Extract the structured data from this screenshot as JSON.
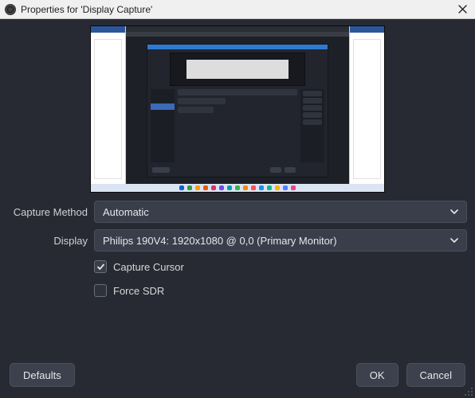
{
  "window": {
    "title": "Properties for 'Display Capture'"
  },
  "form": {
    "capture_method": {
      "label": "Capture Method",
      "value": "Automatic"
    },
    "display": {
      "label": "Display",
      "value": "Philips 190V4: 1920x1080 @ 0,0 (Primary Monitor)"
    },
    "capture_cursor": {
      "label": "Capture Cursor",
      "checked": true
    },
    "force_sdr": {
      "label": "Force SDR",
      "checked": false
    }
  },
  "buttons": {
    "defaults": "Defaults",
    "ok": "OK",
    "cancel": "Cancel"
  },
  "taskbar_icon_colors": [
    "#0b62d6",
    "#2f9e44",
    "#f59f00",
    "#e8590c",
    "#d6336c",
    "#7048e8",
    "#1098ad",
    "#37b24d",
    "#f08c00",
    "#fa5252",
    "#228be6",
    "#12b886",
    "#fab005",
    "#5c7cfa",
    "#e64980"
  ]
}
